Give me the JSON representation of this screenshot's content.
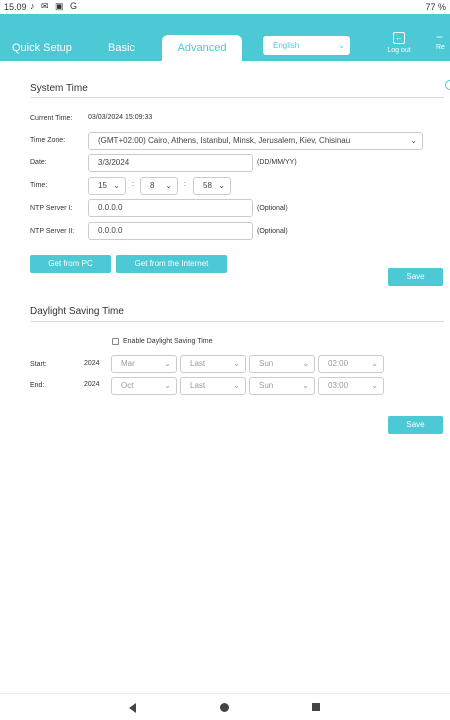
{
  "statusbar": {
    "time": "15.09",
    "icons_left": "♪ ✉ ▣ G",
    "battery": "77 %"
  },
  "header": {
    "tabs": [
      {
        "label": "Quick Setup"
      },
      {
        "label": "Basic"
      },
      {
        "label": "Advanced"
      }
    ],
    "language": "English",
    "logout": "Log out",
    "reboot": "Re"
  },
  "system_time": {
    "title": "System Time",
    "current_time_label": "Current Time:",
    "current_time_value": "03/03/2024 15:09:33",
    "time_zone_label": "Time Zone:",
    "time_zone_value": "(GMT+02:00) Cairo, Athens, Istanbul, Minsk, Jerusalem, Kiev, Chisinau",
    "date_label": "Date:",
    "date_value": "3/3/2024",
    "date_format": "(DD/MM/YY)",
    "time_label": "Time:",
    "hour": "15",
    "minute": "8",
    "second": "58",
    "colon": ":",
    "ntp1_label": "NTP Server I:",
    "ntp1_value": "0.0.0.0",
    "ntp2_label": "NTP Server II:",
    "ntp2_value": "0.0.0.0",
    "optional": "(Optional)",
    "get_from_pc": "Get from PC",
    "get_from_internet": "Get from the Internet",
    "save": "Save"
  },
  "dst": {
    "title": "Daylight Saving Time",
    "enable_label": "Enable Daylight Saving Time",
    "start_label": "Start:",
    "start_year": "2024",
    "start_month": "Mar",
    "start_week": "Last",
    "start_day": "Sun",
    "start_time": "02:00",
    "end_label": "End:",
    "end_year": "2024",
    "end_month": "Oct",
    "end_week": "Last",
    "end_day": "Sun",
    "end_time": "03:00",
    "save": "Save"
  },
  "colors": {
    "accent": "#4cc9d4"
  }
}
